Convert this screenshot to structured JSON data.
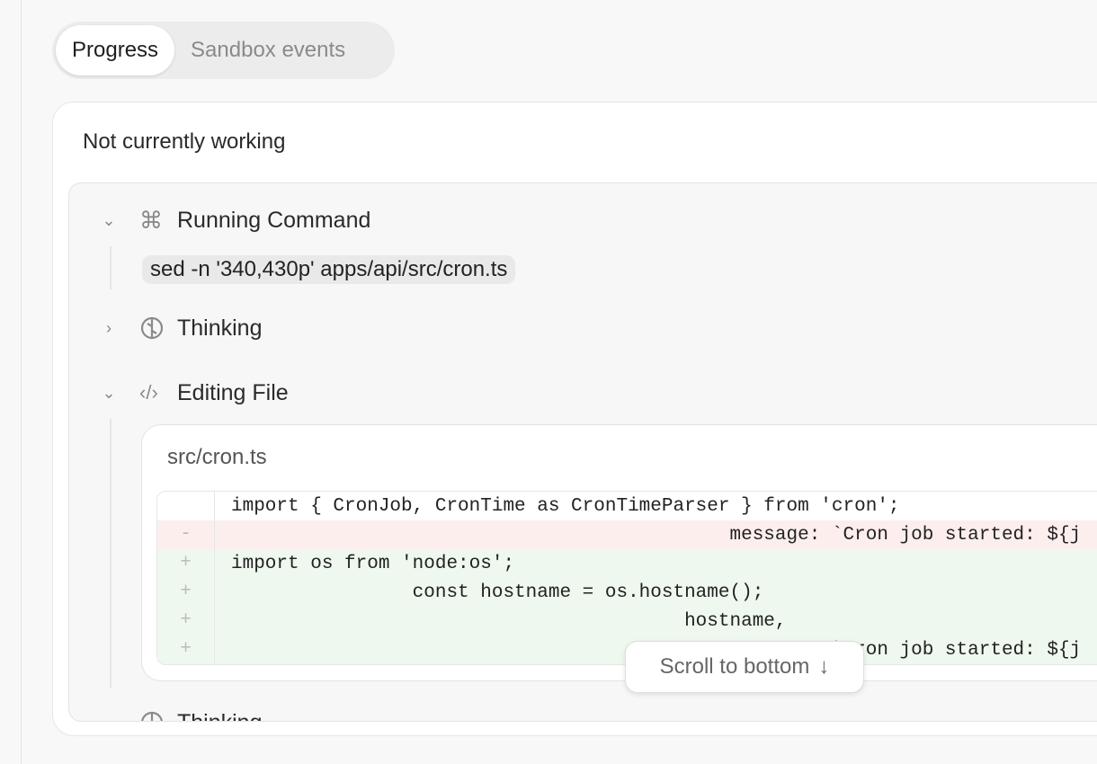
{
  "tabs": [
    {
      "label": "Progress",
      "active": true
    },
    {
      "label": "Sandbox events",
      "active": false
    }
  ],
  "status": "Not currently working",
  "steps": {
    "running_command": {
      "title": "Running Command",
      "icon": "command-icon",
      "expanded": true,
      "command": "sed -n '340,430p' apps/api/src/cron.ts"
    },
    "thinking": {
      "title": "Thinking",
      "icon": "brain-icon",
      "expanded": false
    },
    "editing_file": {
      "title": "Editing File",
      "icon": "code-icon",
      "expanded": true,
      "filename": "src/cron.ts",
      "diff": [
        {
          "type": "context",
          "marker": "",
          "text": "import { CronJob, CronTime as CronTimeParser } from 'cron';"
        },
        {
          "type": "del",
          "marker": "-",
          "text": "                                            message: `Cron job started: ${j"
        },
        {
          "type": "add",
          "marker": "+",
          "text": "import os from 'node:os';"
        },
        {
          "type": "add",
          "marker": "+",
          "text": "                const hostname = os.hostname();"
        },
        {
          "type": "add",
          "marker": "+",
          "text": "                                        hostname,"
        },
        {
          "type": "add",
          "marker": "+",
          "text": "                                                     `Cron job started: ${j"
        }
      ]
    },
    "thinking_2": {
      "title": "Thinking"
    }
  },
  "scroll_button": {
    "label": "Scroll to bottom",
    "icon": "arrow-down-icon"
  }
}
